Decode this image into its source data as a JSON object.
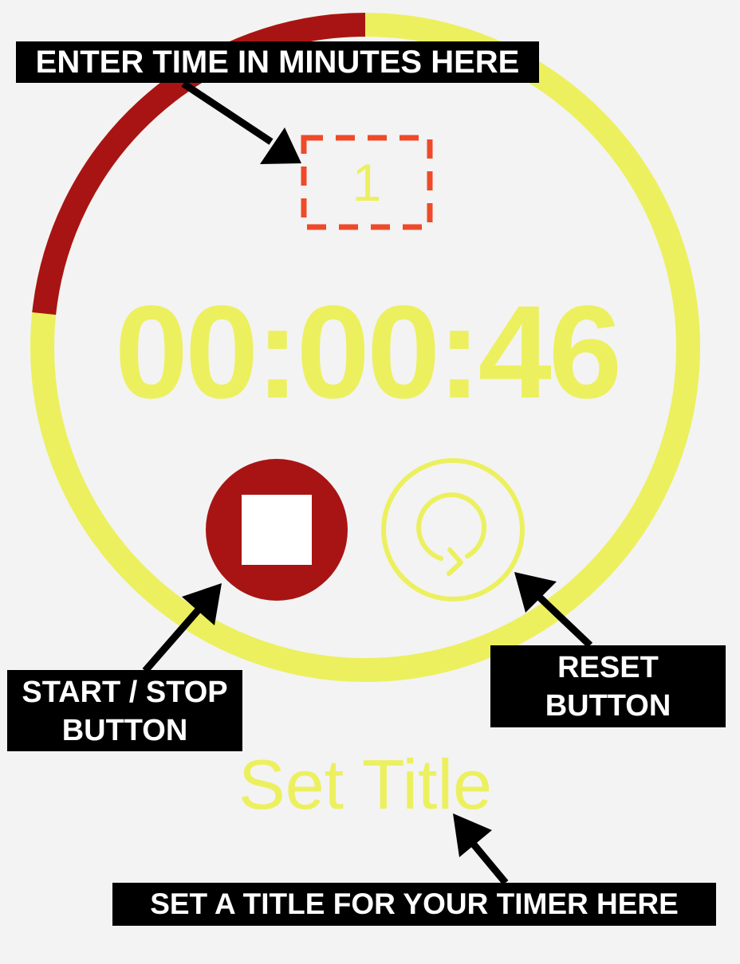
{
  "colors": {
    "background": "#f3f3f3",
    "accent_yellow": "#ecf05e",
    "accent_red": "#a81414",
    "input_border": "#ee4a2a",
    "callout_bg": "#000000",
    "callout_text": "#ffffff"
  },
  "timer": {
    "minutes_value": "1",
    "time_display": "00:00:46",
    "progress_elapsed_fraction": 0.2333,
    "title_placeholder": "Set Title"
  },
  "controls": {
    "start_stop_icon": "stop-icon",
    "reset_icon": "reset-icon"
  },
  "callouts": {
    "minutes": "ENTER TIME IN MINUTES HERE",
    "start_stop_line1": "START / STOP",
    "start_stop_line2": "BUTTON",
    "reset_line1": "RESET",
    "reset_line2": "BUTTON",
    "title": "SET A TITLE FOR YOUR TIMER HERE"
  }
}
